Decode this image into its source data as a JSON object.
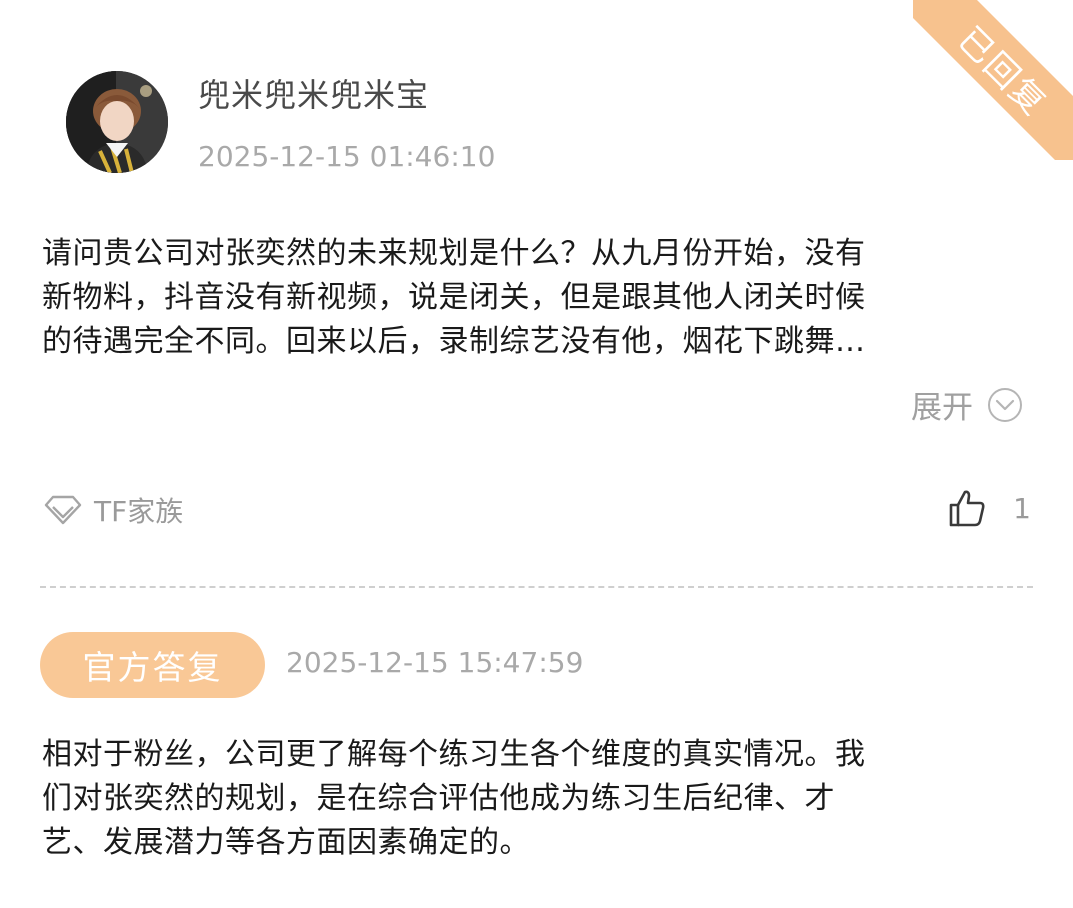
{
  "ribbon": {
    "label": "已回复",
    "color": "#f7c28e"
  },
  "post": {
    "username": "兜米兜米兜米宝",
    "timestamp": "2025-12-15 01:46:10",
    "question_line1": "请问贵公司对张奕然的未来规划是什么？从九月份开始，没有",
    "question_line2": "新物料，抖音没有新视频，说是闭关，但是跟其他人闭关时候",
    "question_line3": "的待遇完全不同。回来以后，录制综艺没有他，烟花下跳舞…",
    "expand_label": "展开",
    "topic_label": "TF家族",
    "like_count": "1"
  },
  "reply": {
    "badge_label": "官方答复",
    "badge_color": "#f9c896",
    "timestamp": "2025-12-15 15:47:59",
    "answer_line1": "相对于粉丝，公司更了解每个练习生各个维度的真实情况。我",
    "answer_line2": "们对张奕然的规划，是在综合评估他成为练习生后纪律、才",
    "answer_line3": "艺、发展潜力等各方面因素确定的。"
  },
  "icons": {
    "expand": "chevron-down-circle-icon",
    "topic": "diamond-icon",
    "like": "thumbs-up-icon"
  }
}
